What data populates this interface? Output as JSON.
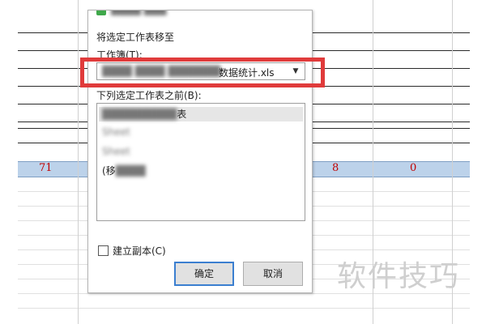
{
  "spreadsheet": {
    "row_values": [
      "71",
      "8",
      "0"
    ],
    "highlight_color": "#bcd2ea",
    "value_color": "#c00000"
  },
  "dialog": {
    "title_blurred": "████ ███",
    "heading": "将选定工作表移至",
    "workbook_label": "工作簿(T):",
    "workbook_value_blurred": "████ ████ ███████",
    "workbook_value": "数据统计.xls",
    "dropdown_icon": "triangle-down-icon",
    "before_sheet_label": "下列选定工作表之前(B):",
    "sheets": [
      {
        "text_blurred": "██████████",
        "text": "表",
        "selected": true
      },
      {
        "text_blurred": "Sheet",
        "text": "",
        "selected": false
      },
      {
        "text_blurred": "Sheet",
        "text": "",
        "selected": false
      },
      {
        "text_prefix": "(移",
        "text_blurred": "████",
        "text": "",
        "selected": false
      }
    ],
    "create_copy_label": "建立副本(C)",
    "create_copy_checked": false,
    "ok_label": "确定",
    "cancel_label": "取消",
    "annotation_color": "#e03b3b"
  },
  "watermark": "软件技巧"
}
